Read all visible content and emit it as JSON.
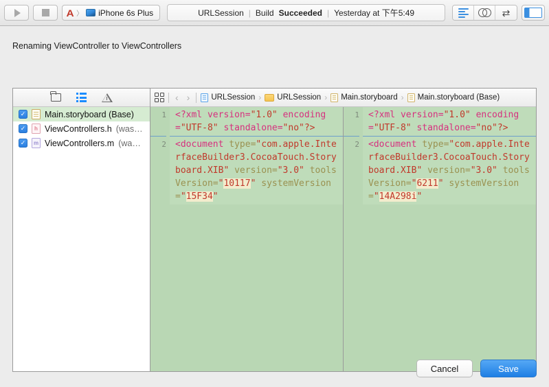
{
  "toolbar": {
    "run_button": "run-icon",
    "stop_button": "stop-icon",
    "scheme_app": "A",
    "scheme_separator": "〉",
    "scheme_device": "iPhone 6s Plus",
    "status": {
      "project": "URLSession",
      "divider": "|",
      "build_label": "Build",
      "build_state": "Succeeded",
      "timestamp": "Yesterday at 下午5:49"
    },
    "editor_modes": [
      "standard-editor",
      "assistant-editor",
      "version-editor"
    ],
    "panel_toggle": "navigator-toggle"
  },
  "sheet": {
    "title": "Renaming ViewController to ViewControllers",
    "cancel_label": "Cancel",
    "save_label": "Save"
  },
  "filelist": {
    "header_icons": [
      "folder-icon",
      "list-icon",
      "warning-icon"
    ],
    "checkmark": "✓",
    "rows": [
      {
        "name": "Main.storyboard (Base)",
        "suffix": "",
        "kind": "storyboard",
        "badge": "",
        "checked": true,
        "selected": true
      },
      {
        "name": "ViewControllers.h",
        "suffix": "(was…",
        "kind": "h",
        "badge": "h",
        "checked": true,
        "selected": false
      },
      {
        "name": "ViewControllers.m",
        "suffix": "(wa…",
        "kind": "m",
        "badge": "m",
        "checked": true,
        "selected": false
      }
    ]
  },
  "breadcrumb": {
    "back": "‹",
    "forward": "›",
    "sep": "›",
    "items": [
      {
        "label": "URLSession",
        "icon": "project-icon"
      },
      {
        "label": "URLSession",
        "icon": "folder-icon"
      },
      {
        "label": "Main.storyboard",
        "icon": "storyboard-icon"
      },
      {
        "label": "Main.storyboard (Base)",
        "icon": "storyboard-icon"
      }
    ]
  },
  "diff": {
    "left": {
      "hunks": [
        {
          "line": "1",
          "tokens": [
            {
              "t": "<?xml ",
              "c": "tg"
            },
            {
              "t": "version=",
              "c": "tg"
            },
            {
              "t": "\"1.0\"",
              "c": "vl"
            },
            {
              "t": " ",
              "c": "tg"
            },
            {
              "t": "encoding=",
              "c": "tg"
            },
            {
              "t": "\"UTF-8\"",
              "c": "vl"
            },
            {
              "t": " ",
              "c": "tg"
            },
            {
              "t": "standalone=",
              "c": "tg"
            },
            {
              "t": "\"no\"?>",
              "c": "vl"
            }
          ]
        },
        {
          "line": "2",
          "tokens": [
            {
              "t": "<document ",
              "c": "tg"
            },
            {
              "t": "type=",
              "c": "at"
            },
            {
              "t": "\"com.apple.InterfaceBuilder3.CocoaTouch.Storyboard.XIB\"",
              "c": "vl"
            },
            {
              "t": " ",
              "c": "at"
            },
            {
              "t": "version=",
              "c": "at"
            },
            {
              "t": "\"3.0\"",
              "c": "vl"
            },
            {
              "t": " ",
              "c": "at"
            },
            {
              "t": "toolsVersion=",
              "c": "at"
            },
            {
              "t": "\"",
              "c": "vl"
            },
            {
              "t": "10117",
              "c": "vl hl"
            },
            {
              "t": "\"",
              "c": "vl"
            },
            {
              "t": " ",
              "c": "at"
            },
            {
              "t": "systemVersion=",
              "c": "at"
            },
            {
              "t": "\"",
              "c": "vl"
            },
            {
              "t": "15F34",
              "c": "vl hl"
            },
            {
              "t": "\"",
              "c": "vl"
            }
          ]
        }
      ]
    },
    "right": {
      "hunks": [
        {
          "line": "1",
          "tokens": [
            {
              "t": "<?xml ",
              "c": "tg"
            },
            {
              "t": "version=",
              "c": "tg"
            },
            {
              "t": "\"1.0\"",
              "c": "vl"
            },
            {
              "t": " ",
              "c": "tg"
            },
            {
              "t": "encoding=",
              "c": "tg"
            },
            {
              "t": "\"UTF-8\"",
              "c": "vl"
            },
            {
              "t": " ",
              "c": "tg"
            },
            {
              "t": "standalone=",
              "c": "tg"
            },
            {
              "t": "\"no\"?>",
              "c": "vl"
            }
          ]
        },
        {
          "line": "2",
          "tokens": [
            {
              "t": "<document ",
              "c": "tg"
            },
            {
              "t": "type=",
              "c": "at"
            },
            {
              "t": "\"com.apple.InterfaceBuilder3.CocoaTouch.Storyboard.XIB\"",
              "c": "vl"
            },
            {
              "t": " ",
              "c": "at"
            },
            {
              "t": "version=",
              "c": "at"
            },
            {
              "t": "\"3.0\"",
              "c": "vl"
            },
            {
              "t": " ",
              "c": "at"
            },
            {
              "t": "toolsVersion=",
              "c": "at"
            },
            {
              "t": "\"",
              "c": "vl"
            },
            {
              "t": "6211",
              "c": "vl hl"
            },
            {
              "t": "\"",
              "c": "vl"
            },
            {
              "t": " ",
              "c": "at"
            },
            {
              "t": "systemVersion=",
              "c": "at"
            },
            {
              "t": "\"",
              "c": "vl"
            },
            {
              "t": "14A298i",
              "c": "vl hl"
            },
            {
              "t": "\"",
              "c": "vl"
            }
          ]
        }
      ]
    }
  },
  "colors": {
    "accent": "#1f7fe4",
    "diff_bg": "#bfdcba",
    "gutter_bg": "#b9d7b4",
    "hunk_rule": "#6c9ecb",
    "highlight": "#f3eccd",
    "tag": "#d6307e",
    "attr": "#9a9150",
    "value": "#c0392b"
  }
}
